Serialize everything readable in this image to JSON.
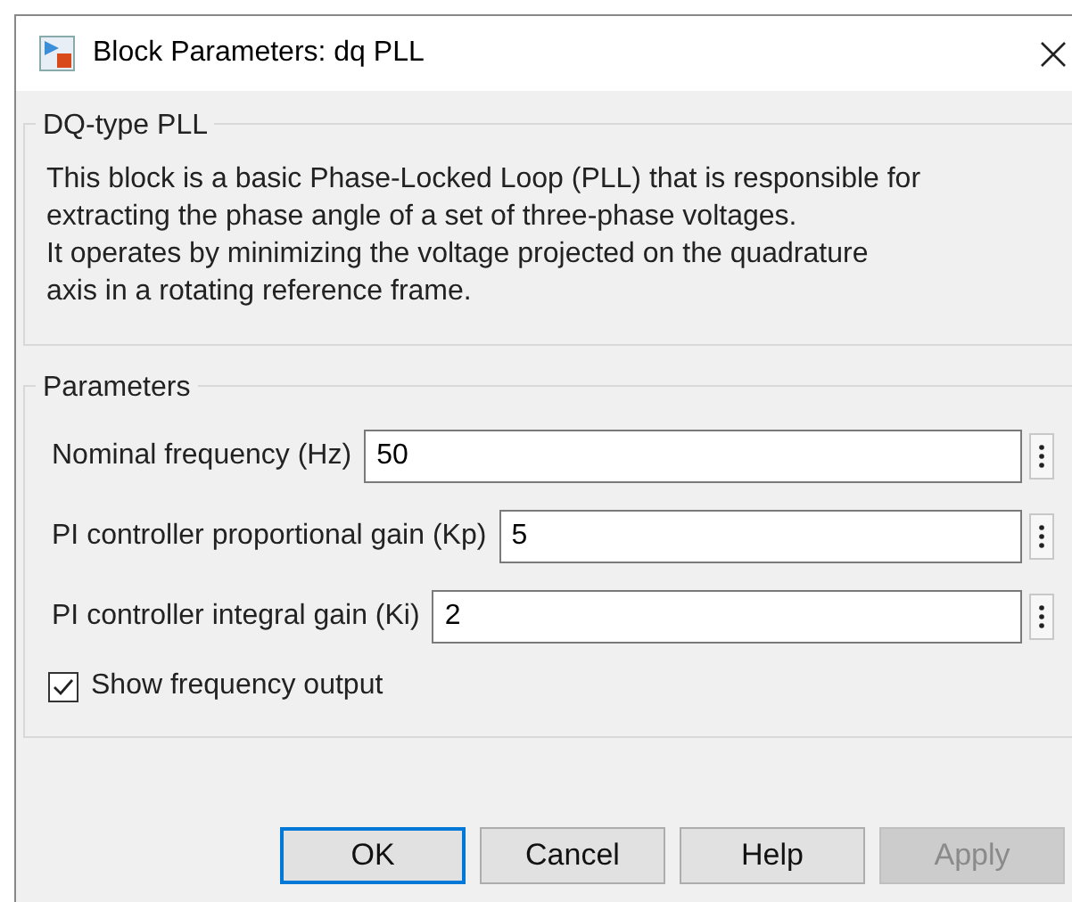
{
  "window": {
    "title": "Block Parameters: dq PLL"
  },
  "description_group": {
    "title": "DQ-type PLL",
    "lines": [
      "This block is a basic Phase-Locked Loop (PLL) that is responsible for",
      "extracting the phase angle of a set of three-phase voltages.",
      "It operates by minimizing the voltage projected on the quadrature",
      "axis in a rotating reference frame."
    ]
  },
  "parameters_group": {
    "title": "Parameters",
    "fields": [
      {
        "label": "Nominal frequency (Hz)",
        "value": "50"
      },
      {
        "label": "PI controller proportional gain (Kp)",
        "value": "5"
      },
      {
        "label": "PI controller integral gain (Ki)",
        "value": "2"
      }
    ],
    "checkbox": {
      "label": "Show frequency output",
      "checked": true
    }
  },
  "buttons": [
    {
      "label": "OK",
      "default": true,
      "disabled": false
    },
    {
      "label": "Cancel",
      "default": false,
      "disabled": false
    },
    {
      "label": "Help",
      "default": false,
      "disabled": false
    },
    {
      "label": "Apply",
      "default": false,
      "disabled": true
    }
  ]
}
